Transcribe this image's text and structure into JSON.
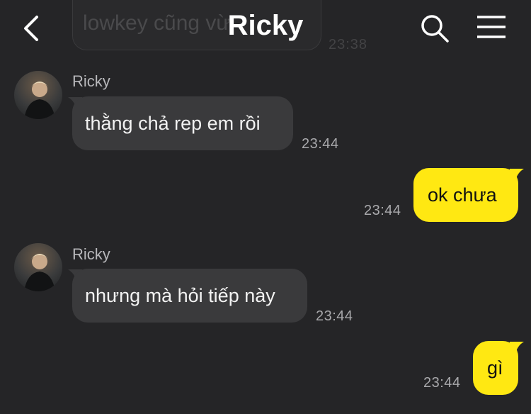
{
  "header": {
    "title": "Ricky",
    "back_icon": "chevron-left-icon",
    "search_icon": "search-icon",
    "menu_icon": "hamburger-menu-icon"
  },
  "previous_message": {
    "text": "lowkey cũng vừ",
    "time": "23:38"
  },
  "messages": [
    {
      "direction": "incoming",
      "sender": "Ricky",
      "text": "thằng chả rep em rồi",
      "time": "23:44"
    },
    {
      "direction": "outgoing",
      "text": "ok chưa",
      "time": "23:44"
    },
    {
      "direction": "incoming",
      "sender": "Ricky",
      "text": "nhưng mà hỏi tiếp này",
      "time": "23:44"
    },
    {
      "direction": "outgoing",
      "text": "gì",
      "time": "23:44"
    }
  ],
  "colors": {
    "background": "#252527",
    "incoming_bubble": "#3a3a3c",
    "outgoing_bubble": "#ffe812"
  }
}
